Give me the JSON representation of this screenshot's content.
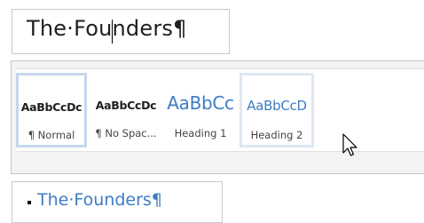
{
  "document_top": {
    "text": "The·Founders¶"
  },
  "style_gallery": {
    "styles": [
      {
        "sample": "AaBbCcDc",
        "label": "¶ Normal",
        "state": "selected"
      },
      {
        "sample": "AaBbCcDc",
        "label": "¶ No Spac...",
        "state": "normal"
      },
      {
        "sample": "AaBbCc",
        "label": "Heading 1",
        "state": "normal"
      },
      {
        "sample": "AaBbCcD",
        "label": "Heading 2",
        "state": "hovered"
      }
    ]
  },
  "document_bottom": {
    "text": "The·Founders¶",
    "color": "#3e7cc5"
  },
  "colors": {
    "heading_blue": "#3e7cc5",
    "selected_border": "#c5d7ee",
    "hover_border": "#dde7f4"
  }
}
